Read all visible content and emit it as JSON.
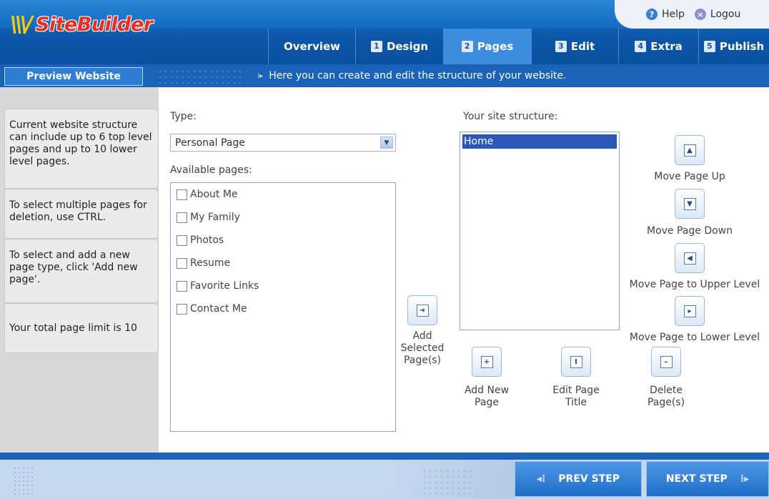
{
  "app": {
    "logo_text": "SiteBuilder",
    "logo_mark": "\\\\\\/"
  },
  "helpbar": {
    "help": "Help",
    "logout": "Logou"
  },
  "tabs": [
    {
      "num": "",
      "label": "Overview"
    },
    {
      "num": "1",
      "label": "Design"
    },
    {
      "num": "2",
      "label": "Pages"
    },
    {
      "num": "3",
      "label": "Edit"
    },
    {
      "num": "4",
      "label": "Extra"
    },
    {
      "num": "5",
      "label": "Publish"
    }
  ],
  "preview_button": "Preview Website",
  "hint": "Here you can create and edit the structure of your website.",
  "sidebar": {
    "tips": [
      "Current website structure can include up to 6 top level pages and up to 10 lower level pages.",
      "To select multiple pages for deletion, use CTRL.",
      "To select and add a new page type, click 'Add new page'.",
      "Your total page limit is 10"
    ]
  },
  "type": {
    "label": "Type:",
    "selected": "Personal Page"
  },
  "available": {
    "label": "Available pages:",
    "items": [
      "About Me",
      "My Family",
      "Photos",
      "Resume",
      "Favorite Links",
      "Contact Me"
    ]
  },
  "add_selected": {
    "line1": "Add",
    "line2": "Selected",
    "line3": "Page(s)"
  },
  "structure": {
    "label": "Your site structure:",
    "items": [
      "Home"
    ]
  },
  "actions": {
    "move_up": "Move Page Up",
    "move_down": "Move Page Down",
    "upper_level": "Move Page to Upper Level",
    "lower_level": "Move Page to Lower Level",
    "add_new_1": "Add New",
    "add_new_2": "Page",
    "edit_title_1": "Edit Page",
    "edit_title_2": "Title",
    "delete_1": "Delete",
    "delete_2": "Page(s)"
  },
  "footer": {
    "prev": "PREV STEP",
    "next": "NEXT STEP"
  },
  "colors": {
    "header_blue": "#0c56a8",
    "active_tab": "#3c8de0",
    "selection": "#2b58b8",
    "logo_red": "#e83020",
    "logo_yellow": "#ffcc00"
  }
}
